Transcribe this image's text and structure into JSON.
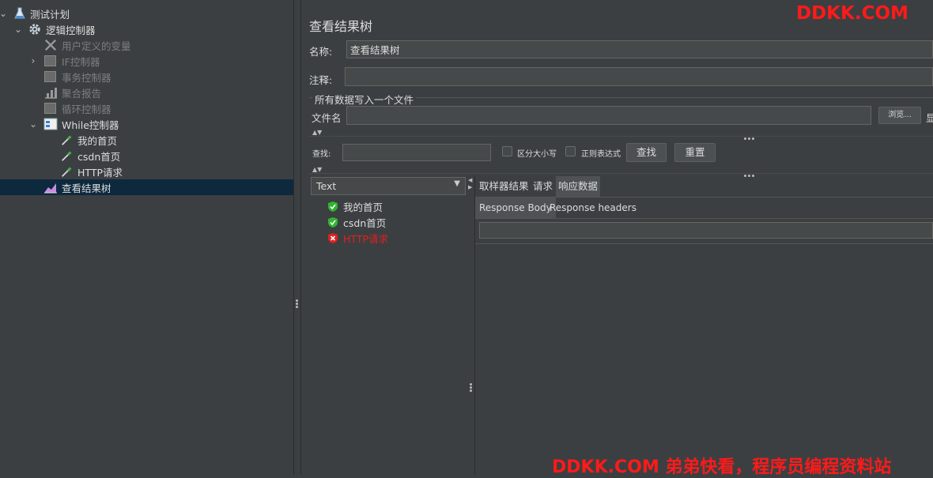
{
  "tree": {
    "items": [
      {
        "label": "测试计划",
        "icon": "flask-icon",
        "disabled": false
      },
      {
        "label": "逻辑控制器",
        "icon": "gear-icon",
        "disabled": false
      },
      {
        "label": "用户定义的变量",
        "icon": "wrench-icon",
        "disabled": true
      },
      {
        "label": "IF控制器",
        "icon": "controller-box-icon",
        "disabled": true
      },
      {
        "label": "事务控制器",
        "icon": "controller-box-icon",
        "disabled": true
      },
      {
        "label": "聚合报告",
        "icon": "chart-icon",
        "disabled": true
      },
      {
        "label": "循环控制器",
        "icon": "controller-box-icon",
        "disabled": true
      },
      {
        "label": "While控制器",
        "icon": "while-icon",
        "disabled": false
      },
      {
        "label": "我的首页",
        "icon": "pipette-icon",
        "disabled": false
      },
      {
        "label": "csdn首页",
        "icon": "pipette-icon",
        "disabled": false
      },
      {
        "label": "HTTP请求",
        "icon": "pipette-icon",
        "disabled": false
      },
      {
        "label": "查看结果树",
        "icon": "result-tree-icon",
        "disabled": false
      }
    ]
  },
  "panel": {
    "title": "查看结果树",
    "name_label": "名称:",
    "name_value": "查看结果树",
    "comment_label": "注释:",
    "comment_value": "",
    "file_section": "所有数据写入一个文件",
    "filename_label": "文件名",
    "filename_value": "",
    "browse_label": "浏览...",
    "display_cut": "显"
  },
  "search": {
    "label": "查找:",
    "value": "",
    "case_label": "区分大小写",
    "regex_label": "正则表达式",
    "find_button": "查找",
    "reset_button": "重置"
  },
  "renderer": {
    "selected": "Text"
  },
  "results": [
    {
      "label": "我的首页",
      "status": "success"
    },
    {
      "label": "csdn首页",
      "status": "success"
    },
    {
      "label": "HTTP请求",
      "status": "error"
    }
  ],
  "tabs": {
    "main": [
      "取样器结果",
      "请求",
      "响应数据"
    ],
    "active_main": 2,
    "sub": [
      "Response Body",
      "Response headers"
    ],
    "active_sub": 0
  },
  "watermarks": {
    "top": "DDKK.COM",
    "bottom": "DDKK.COM 弟弟快看，程序员编程资料站"
  },
  "colors": {
    "success": "#2fb52f",
    "error": "#e02020",
    "watermark": "#ff1a1a",
    "selection": "#0d293e"
  }
}
